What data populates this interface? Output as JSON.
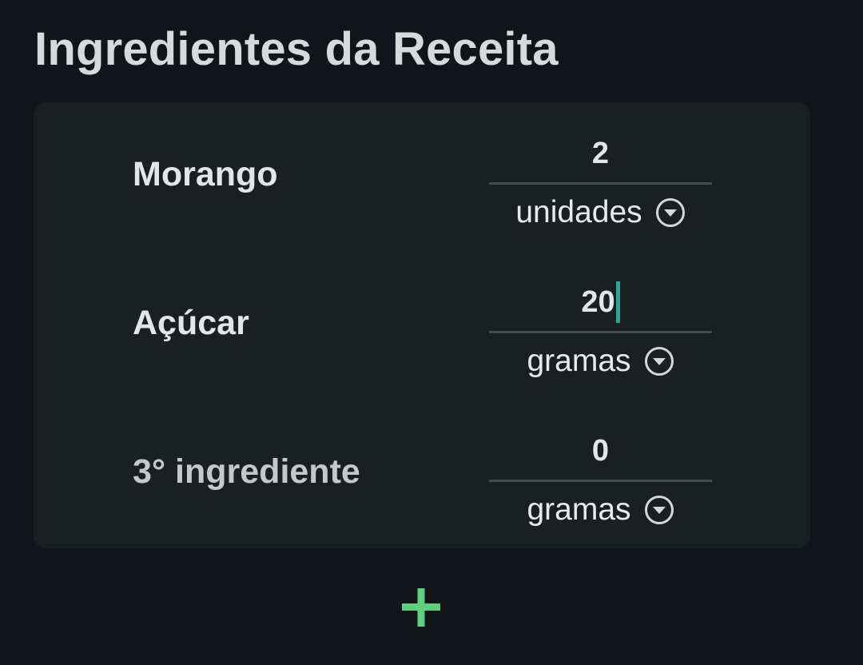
{
  "header": {
    "title": "Ingredientes da Receita"
  },
  "ingredients": [
    {
      "name": "Morango",
      "quantity": "2",
      "unit": "unidades",
      "is_placeholder": false,
      "focused": false
    },
    {
      "name": "Açúcar",
      "quantity": "20",
      "unit": "gramas",
      "is_placeholder": false,
      "focused": true
    },
    {
      "name": "3° ingrediente",
      "quantity": "0",
      "unit": "gramas",
      "is_placeholder": true,
      "focused": false
    }
  ],
  "icons": {
    "dropdown": "chevron-down-circle-icon",
    "add": "plus-icon"
  },
  "colors": {
    "background": "#111418",
    "card": "#1a1f22",
    "accent": "#2aa78e",
    "add": "#5fcf7f"
  }
}
